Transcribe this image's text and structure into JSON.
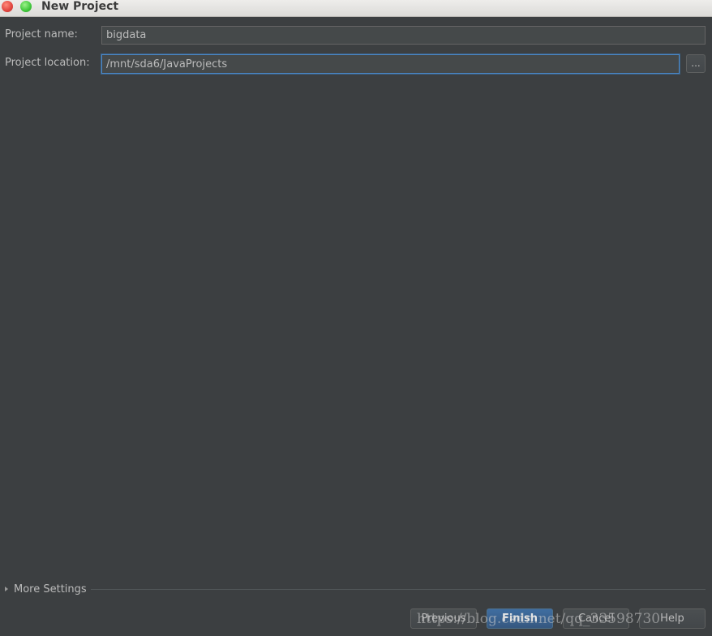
{
  "window": {
    "title": "New Project",
    "buttons": [
      "close-icon",
      "maximize-icon"
    ]
  },
  "form": {
    "project_name_label": "Project name:",
    "project_name_value": "bigdata",
    "project_location_label": "Project location:",
    "project_location_value": "/mnt/sda6/JavaProjects",
    "browse_label": "..."
  },
  "more_settings": {
    "label": "More Settings",
    "icon": "expand-triangle-icon"
  },
  "footer": {
    "previous_label": "Previous",
    "finish_label": "Finish",
    "cancel_label": "Cancel",
    "help_label": "Help"
  },
  "watermark": "https://blog.csdn.net/qq_33598730",
  "colors": {
    "background": "#3c3f41",
    "field_background": "#45494a",
    "focus_border": "#4a88c7",
    "default_button": "#365880"
  }
}
